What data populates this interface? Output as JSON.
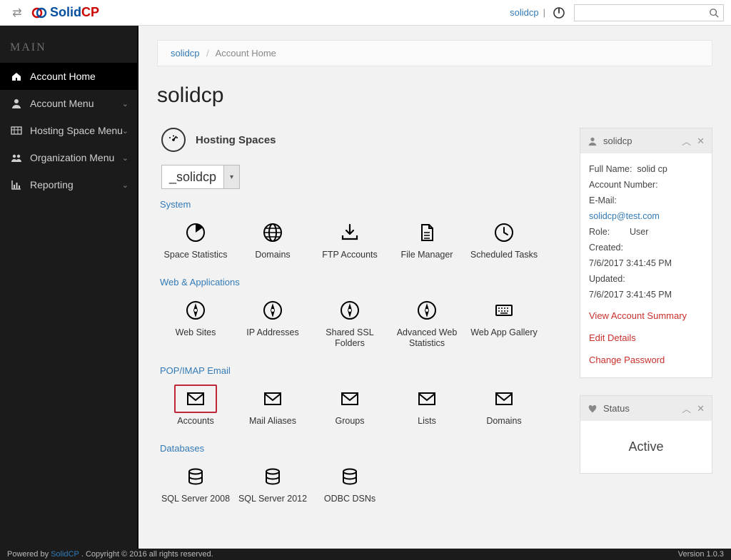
{
  "topbar": {
    "user_link": "solidcp",
    "search_placeholder": ""
  },
  "logo": {
    "part1": "Solid",
    "part2": "CP"
  },
  "sidebar": {
    "section": "MAIN",
    "items": [
      {
        "label": "Account Home",
        "icon": "home",
        "active": true
      },
      {
        "label": "Account Menu",
        "icon": "user",
        "expandable": true
      },
      {
        "label": "Hosting Space Menu",
        "icon": "grid",
        "expandable": true
      },
      {
        "label": "Organization Menu",
        "icon": "org",
        "expandable": true
      },
      {
        "label": "Reporting",
        "icon": "chart",
        "expandable": true
      }
    ]
  },
  "breadcrumb": {
    "root": "solidcp",
    "current": "Account Home"
  },
  "page_title": "solidcp",
  "spaces": {
    "heading": "Hosting Spaces",
    "selected": "_solidcp",
    "categories": [
      {
        "name": "System",
        "tiles": [
          {
            "label": "Space Statistics",
            "icon": "pie"
          },
          {
            "label": "Domains",
            "icon": "globe"
          },
          {
            "label": "FTP Accounts",
            "icon": "download"
          },
          {
            "label": "File Manager",
            "icon": "file"
          },
          {
            "label": "Scheduled Tasks",
            "icon": "clock"
          }
        ]
      },
      {
        "name": "Web & Applications",
        "tiles": [
          {
            "label": "Web Sites",
            "icon": "compass"
          },
          {
            "label": "IP Addresses",
            "icon": "compass"
          },
          {
            "label": "Shared SSL Folders",
            "icon": "compass"
          },
          {
            "label": "Advanced Web Statistics",
            "icon": "compass"
          },
          {
            "label": "Web App Gallery",
            "icon": "keyboard"
          }
        ]
      },
      {
        "name": "POP/IMAP Email",
        "tiles": [
          {
            "label": "Accounts",
            "icon": "mail",
            "highlight": true
          },
          {
            "label": "Mail Aliases",
            "icon": "mail"
          },
          {
            "label": "Groups",
            "icon": "mail"
          },
          {
            "label": "Lists",
            "icon": "mail"
          },
          {
            "label": "Domains",
            "icon": "mail"
          }
        ]
      },
      {
        "name": "Databases",
        "tiles": [
          {
            "label": "SQL Server 2008",
            "icon": "db"
          },
          {
            "label": "SQL Server 2012",
            "icon": "db"
          },
          {
            "label": "ODBC DSNs",
            "icon": "db"
          }
        ]
      }
    ]
  },
  "account_panel": {
    "title": "solidcp",
    "full_name_label": "Full Name:",
    "full_name": "solid cp",
    "account_number_label": "Account Number:",
    "account_number": "",
    "email_label": "E-Mail:",
    "email": "solidcp@test.com",
    "role_label": "Role:",
    "role": "User",
    "created_label": "Created:",
    "created": "7/6/2017 3:41:45 PM",
    "updated_label": "Updated:",
    "updated": "7/6/2017 3:41:45 PM",
    "actions": [
      "View Account Summary",
      "Edit Details",
      "Change Password"
    ]
  },
  "status_panel": {
    "title": "Status",
    "value": "Active"
  },
  "footer": {
    "prefix": "Powered by",
    "link": "SolidCP",
    "suffix": ". Copyright © 2016 all rights reserved.",
    "version": "Version 1.0.3"
  }
}
